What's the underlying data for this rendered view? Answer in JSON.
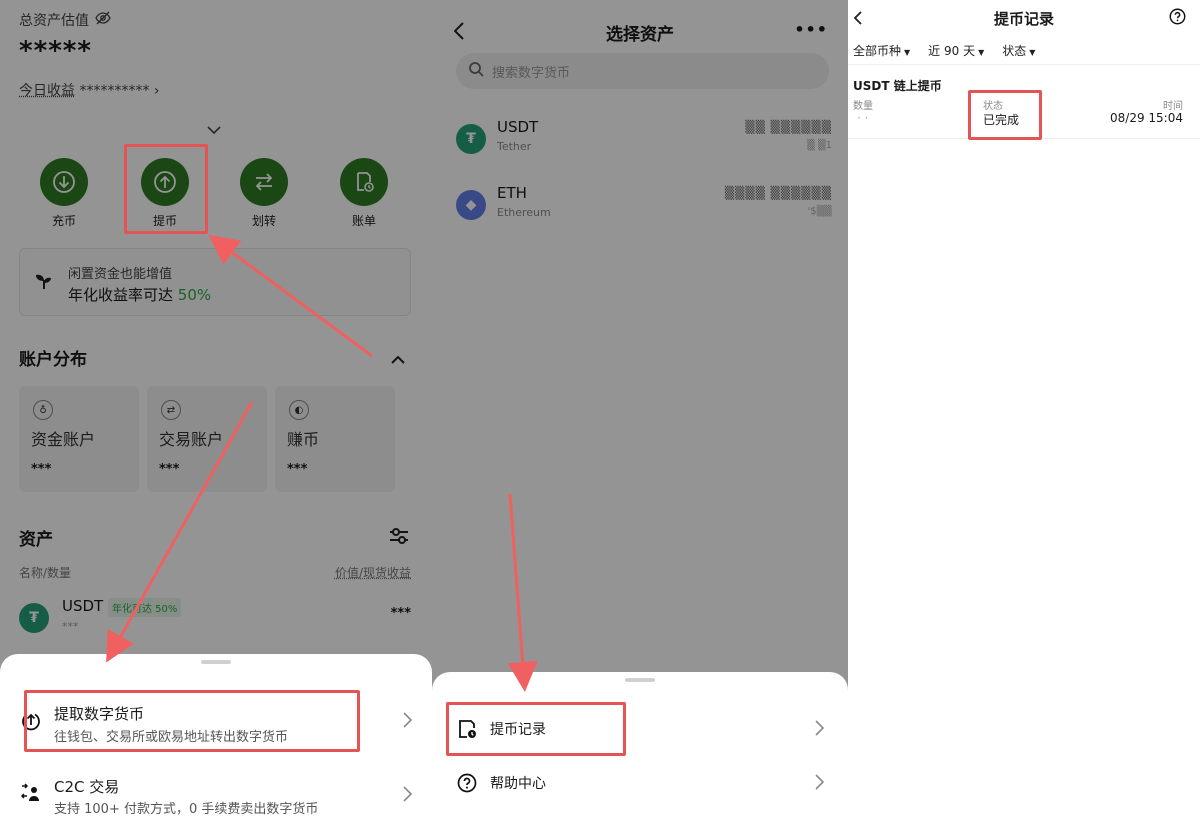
{
  "panel1": {
    "total_label": "总资产估值",
    "total_masked": "*****",
    "today_label": "今日收益",
    "today_masked": "**********",
    "actions": [
      {
        "label": "充币"
      },
      {
        "label": "提币"
      },
      {
        "label": "划转"
      },
      {
        "label": "账单"
      }
    ],
    "promo": {
      "line1": "闲置资金也能增值",
      "line2_prefix": "年化收益率可达",
      "line2_rate": "50%"
    },
    "accounts_title": "账户分布",
    "accounts": [
      {
        "name": "资金账户",
        "value": "***"
      },
      {
        "name": "交易账户",
        "value": "***"
      },
      {
        "name": "赚币",
        "value": "***"
      }
    ],
    "assets_title": "资产",
    "col_left": "名称/数量",
    "col_right": "价值/现货收益",
    "asset_row": {
      "symbol": "USDT",
      "tag": "年化可达 50%",
      "amount": "***",
      "value": "***"
    },
    "sheet": [
      {
        "title": "提取数字货币",
        "sub": "往钱包、交易所或欧易地址转出数字货币"
      },
      {
        "title": "C2C 交易",
        "sub": "支持 100+ 付款方式，0 手续费卖出数字货币"
      }
    ]
  },
  "panel2": {
    "title": "选择资产",
    "more": "•••",
    "search_placeholder": "搜索数字货币",
    "assets": [
      {
        "symbol": "USDT",
        "name": "Tether",
        "amount": "▒▒ ▒▒▒▒▒▒",
        "sub": "▒ ▒1"
      },
      {
        "symbol": "ETH",
        "name": "Ethereum",
        "amount": "▒▒▒▒ ▒▒▒▒▒▒",
        "sub": "'$▒▒"
      }
    ],
    "sheet": [
      {
        "title": "提币记录"
      },
      {
        "title": "帮助中心"
      }
    ]
  },
  "panel3": {
    "title": "提币记录",
    "filters": [
      "全部币种",
      "近 90 天",
      "状态"
    ],
    "record": {
      "title": "USDT 链上提币",
      "qty_label": "数量",
      "qty_value": "· ·",
      "status_label": "状态",
      "status_value": "已完成",
      "time_label": "时间",
      "time_value": "08/29 15:04"
    }
  },
  "colors": {
    "accent_green": "#2d7a24",
    "highlight_red": "#e55454",
    "rate_green": "#2fa64a"
  }
}
